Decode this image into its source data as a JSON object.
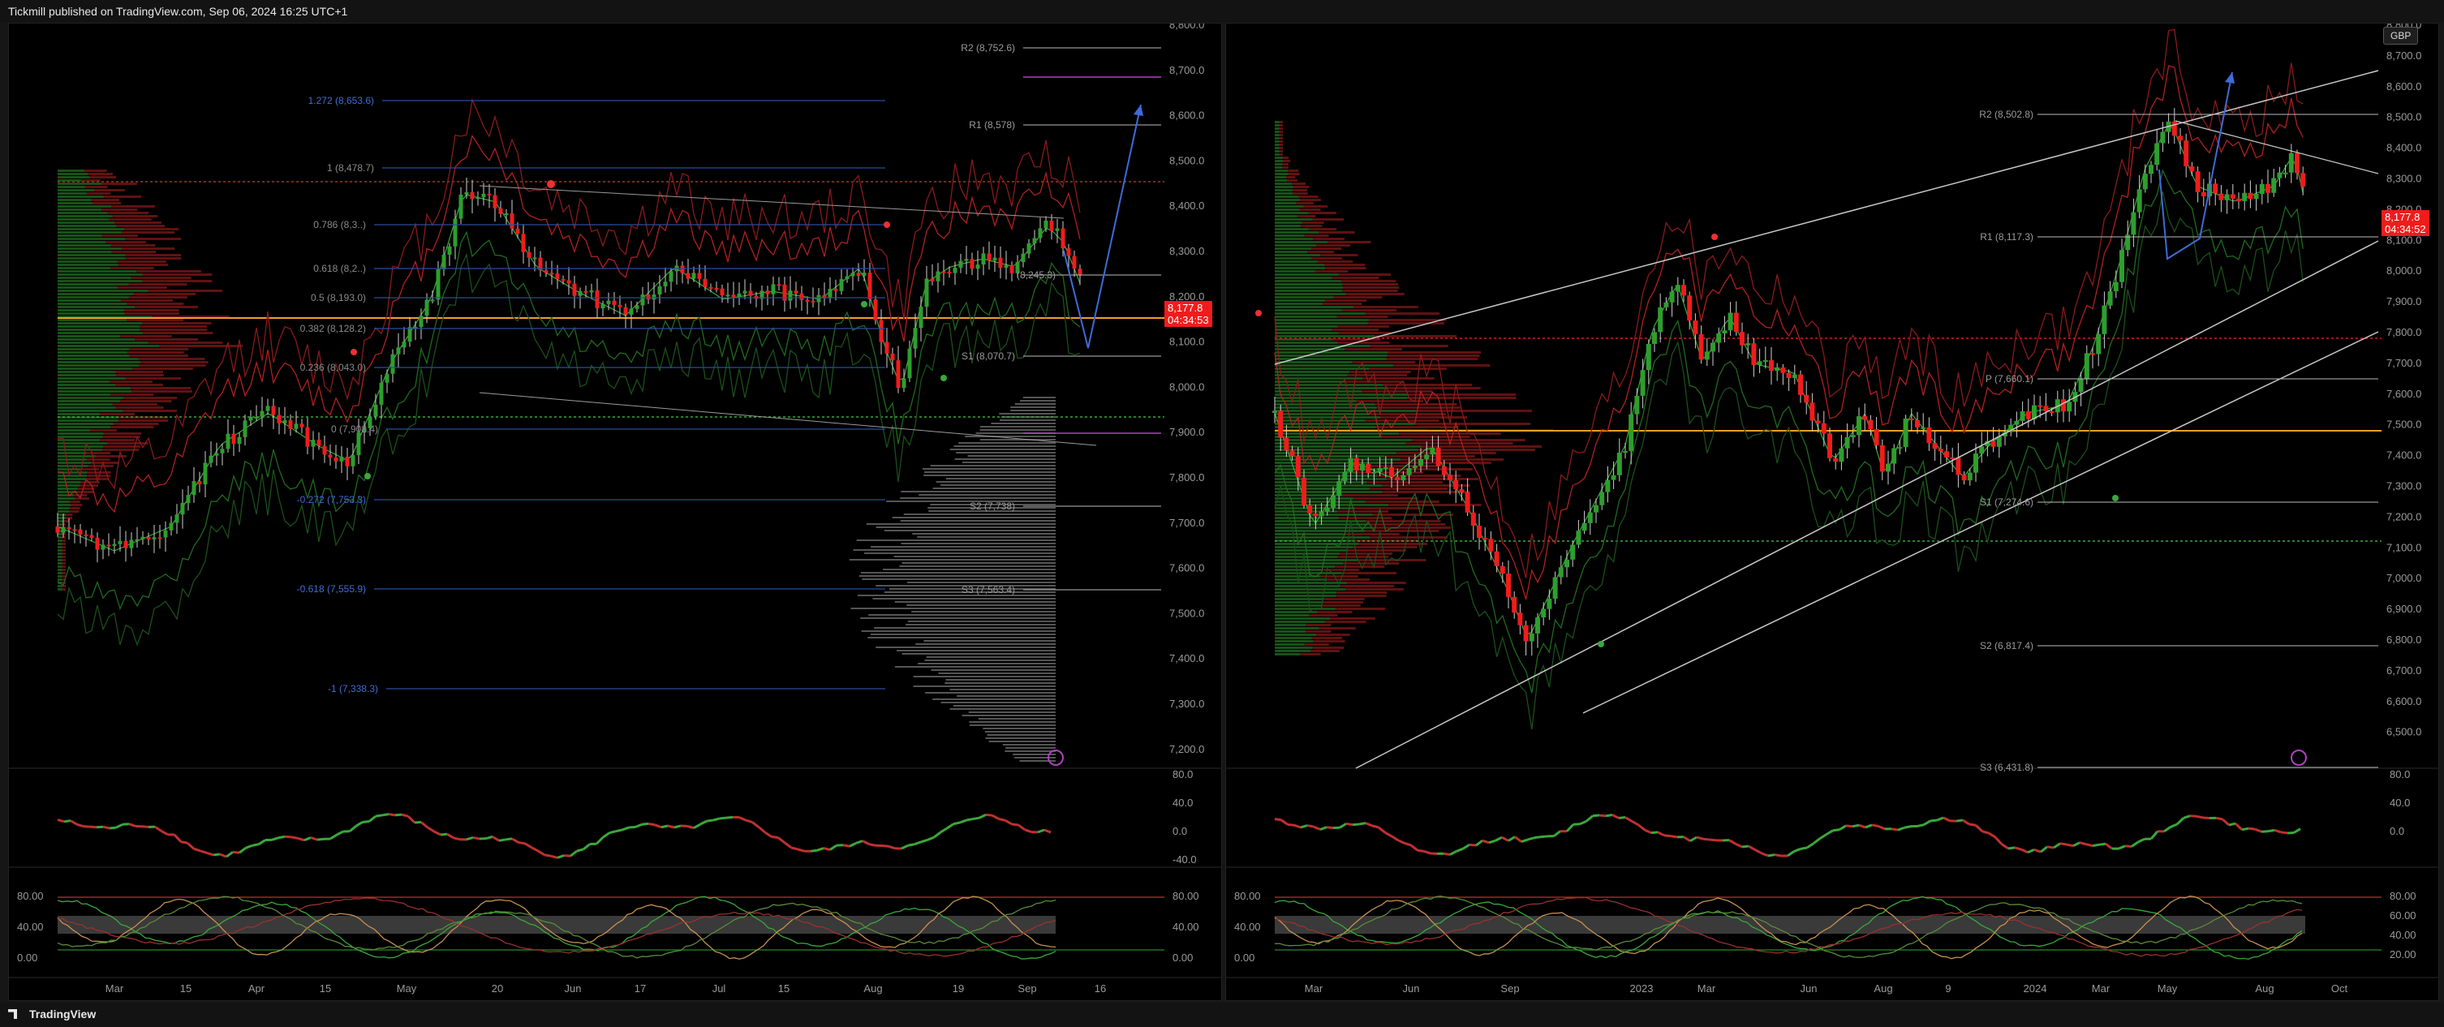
{
  "header": {
    "publish_text": "Tickmill published on TradingView.com, Sep 06, 2024 16:25 UTC+1"
  },
  "footer": {
    "brand": "TradingView"
  },
  "colors": {
    "up": "#2e9e2e",
    "down": "#f01c1c",
    "poc": "#f0a020",
    "fib": "#3f6bd8",
    "pivot": "#c8c8c8",
    "background": "#000000"
  },
  "left_chart": {
    "price_axis": [
      "8,800.0",
      "8,700.0",
      "8,600.0",
      "8,500.0",
      "8,400.0",
      "8,300.0",
      "8,200.0",
      "8,100.0",
      "8,000.0",
      "7,900.0",
      "7,800.0",
      "7,700.0",
      "7,600.0",
      "7,500.0",
      "7,400.0",
      "7,300.0",
      "7,200.0"
    ],
    "time_axis": [
      "Mar",
      "15",
      "Apr",
      "15",
      "May",
      "20",
      "Jun",
      "17",
      "Jul",
      "15",
      "Aug",
      "19",
      "Sep",
      "16"
    ],
    "current_price": "8,177.8",
    "countdown": "04:34:53",
    "fib_levels": [
      "1.272 (8,653.6)",
      "1 (8,478.7)",
      "0.786 (8,3..)",
      "0.618 (8,2..)",
      "0.5 (8,193.0)",
      "0.382 (8,128.2)",
      "0.236 (8,043.0)",
      "0 (7,908.4)",
      "-0.272 (7,753.3)",
      "-0.618 (7,555.9)",
      "-1 (7,338.3)"
    ],
    "pivot_levels": [
      "R2 (8,752.6)",
      "R1 (8,578)",
      "(8,245.3)",
      "S1 (8,070.7)",
      "S2 (7,738)",
      "S3 (7,563.4)"
    ],
    "rsi_axis": [
      "80.0",
      "40.0",
      "0.0",
      "-40.0"
    ],
    "stoch_axis_left": [
      "80.00",
      "40.00",
      "0.00"
    ],
    "stoch_axis_right": [
      "80.00",
      "40.00",
      "0.00"
    ]
  },
  "right_chart": {
    "currency_badge": "GBP",
    "price_axis": [
      "8,800.0",
      "8,700.0",
      "8,600.0",
      "8,500.0",
      "8,400.0",
      "8,300.0",
      "8,200.0",
      "8,100.0",
      "8,000.0",
      "7,900.0",
      "7,800.0",
      "7,700.0",
      "7,600.0",
      "7,500.0",
      "7,400.0",
      "7,300.0",
      "7,200.0",
      "7,100.0",
      "7,000.0",
      "6,900.0",
      "6,800.0",
      "6,700.0",
      "6,600.0",
      "6,500.0"
    ],
    "time_axis": [
      "Mar",
      "Jun",
      "Sep",
      "2023",
      "Mar",
      "Jun",
      "Aug",
      "9",
      "2024",
      "Mar",
      "May",
      "Aug",
      "Oct"
    ],
    "current_price": "8,177.8",
    "countdown": "04:34:52",
    "pivot_levels": [
      "R2 (8,502.8)",
      "R1 (8,117.3)",
      "P (7,660.1)",
      "S1 (7,274.6)",
      "S2 (6,817.4)",
      "S3 (6,431.8)"
    ],
    "rsi_axis": [
      "80.0",
      "40.0",
      "0.0"
    ],
    "stoch_axis_left": [
      "80.00",
      "40.00",
      "0.00"
    ],
    "stoch_axis_right": [
      "80.00",
      "60.00",
      "40.00",
      "20.00"
    ]
  }
}
